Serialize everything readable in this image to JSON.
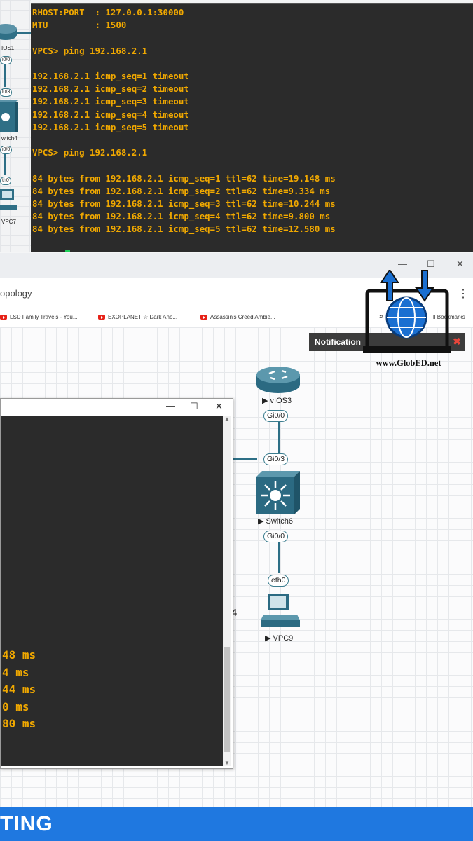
{
  "top_terminal": {
    "lines": [
      "RHOST:PORT  : 127.0.0.1:30000",
      "MTU         : 1500",
      "",
      "VPCS> ping 192.168.2.1",
      "",
      "192.168.2.1 icmp_seq=1 timeout",
      "192.168.2.1 icmp_seq=2 timeout",
      "192.168.2.1 icmp_seq=3 timeout",
      "192.168.2.1 icmp_seq=4 timeout",
      "192.168.2.1 icmp_seq=5 timeout",
      "",
      "VPCS> ping 192.168.2.1",
      "",
      "84 bytes from 192.168.2.1 icmp_seq=1 ttl=62 time=19.148 ms",
      "84 bytes from 192.168.2.1 icmp_seq=2 ttl=62 time=9.334 ms",
      "84 bytes from 192.168.2.1 icmp_seq=3 ttl=62 time=10.244 ms",
      "84 bytes from 192.168.2.1 icmp_seq=4 ttl=62 time=9.800 ms",
      "84 bytes from 192.168.2.1 icmp_seq=5 ttl=62 time=12.580 ms",
      "",
      "VPCS> "
    ]
  },
  "left_topology": {
    "router_label": "IOS1",
    "port1": "i0/0",
    "port2": "i0/3",
    "switch_label": "witch4",
    "port3": "i0/0",
    "port4": "th0",
    "pc_label": "VPC7"
  },
  "browser": {
    "tab_title": "opology",
    "bookmarks": [
      "LSD Family Travels - You...",
      "EXOPLANET ☆ Dark Ano...",
      "Assassin's Creed Ambie..."
    ],
    "bookmarks_overflow": "»",
    "all_bookmarks": "ll Bookmarks",
    "menu_icon": "⋮"
  },
  "inner_terminal": {
    "lines": [
      "48 ms",
      "4 ms",
      "44 ms",
      "0 ms",
      "80 ms"
    ]
  },
  "topology": {
    "router_label": "▶ vIOS3",
    "router_port": "Gi0/0",
    "switch_port_top": "Gi0/3",
    "switch_label": "▶ Switch6",
    "switch_port_bottom": "Gi0/0",
    "pc_port": "eth0",
    "pc_label": "▶ VPC9",
    "stray_text": "4"
  },
  "notification": {
    "title": "Notification",
    "close": "✖"
  },
  "logo": {
    "site": "www.GlobED.net"
  },
  "banner": {
    "text": "TING"
  },
  "colors": {
    "terminal_bg": "#2b2b2b",
    "terminal_text": "#f0a800",
    "banner": "#1f78e0",
    "cursor": "#1fd05a"
  }
}
